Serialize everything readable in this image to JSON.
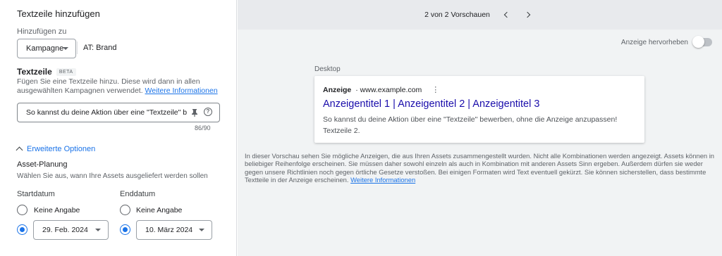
{
  "left": {
    "title": "Textzeile hinzufügen",
    "add_to_label": "Hinzufügen zu",
    "campaign_select": "Kampagne",
    "campaign_name": "AT: Brand",
    "textzeile_title": "Textzeile",
    "beta_badge": "BETA",
    "textzeile_desc": "Fügen Sie eine Textzeile hinzu. Diese wird dann in allen ausgewählten Kampagnen verwendet.",
    "learn_more": "Weitere Informationen",
    "input_value": "So kannst du deine Aktion über eine \"Textzeile\" bewerben, ohne die Anzeige anzupassen!",
    "counter": "86/90",
    "advanced_options": "Erweiterte Optionen",
    "asset_planning": "Asset-Planung",
    "asset_planning_desc": "Wählen Sie aus, wann Ihre Assets ausgeliefert werden sollen",
    "start": {
      "label": "Startdatum",
      "no_value": "Keine Angabe",
      "date": "29. Feb. 2024"
    },
    "end": {
      "label": "Enddatum",
      "no_value": "Keine Angabe",
      "date": "10. März 2024"
    }
  },
  "right": {
    "pager": "2 von 2 Vorschauen",
    "highlight_label": "Anzeige hervorheben",
    "highlight_on": false,
    "device_label": "Desktop",
    "ad": {
      "badge": "Anzeige",
      "url": "· www.example.com",
      "headline": "Anzeigentitel 1 | Anzeigentitel 2 | Anzeigentitel 3",
      "description": "So kannst du deine Aktion über eine \"Textzeile\" bewerben, ohne die Anzeige anzupassen!",
      "textline": "Textzeile 2."
    },
    "disclaimer": "In dieser Vorschau sehen Sie mögliche Anzeigen, die aus Ihren Assets zusammengestellt wurden. Nicht alle Kombinationen werden angezeigt. Assets können in beliebiger Reihenfolge erscheinen. Sie müssen daher sowohl einzeln als auch in Kombination mit anderen Assets Sinn ergeben. Außerdem dürfen sie weder gegen unsere Richtlinien noch gegen örtliche Gesetze verstoßen. Bei einigen Formaten wird Text eventuell gekürzt. Sie können sicherstellen, dass bestimmte Textteile in der Anzeige erscheinen.",
    "disclaimer_link": "Weitere Informationen"
  },
  "colors": {
    "accent": "#1a73e8",
    "headline": "#1a0dab",
    "preview_bg": "#f1f3f4"
  },
  "icons": {
    "pin": "pin-icon",
    "help": "help-icon",
    "prev": "chevron-left-icon",
    "next": "chevron-right-icon",
    "more": "more-vert-icon",
    "collapse": "chevron-up-icon",
    "dropdown": "dropdown-caret-icon"
  }
}
